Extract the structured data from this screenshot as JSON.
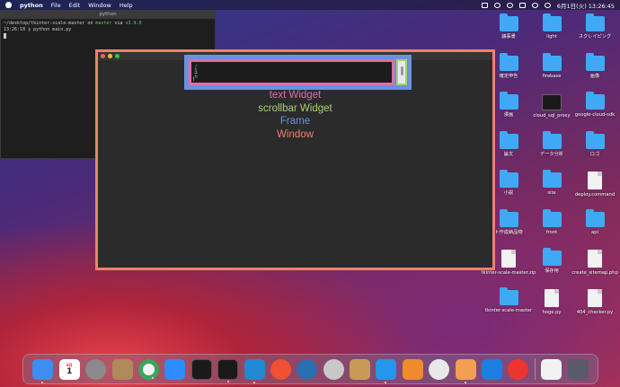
{
  "menubar": {
    "app_name": "python",
    "menus": [
      "File",
      "Edit",
      "Window",
      "Help"
    ],
    "clock": "6月1日(火) 13:26:45"
  },
  "terminal": {
    "title": "python",
    "prompt_path": "~/desktop/tkinter-scale-master",
    "on": "on",
    "branch": "master",
    "via": "via",
    "python_version": "v3.9.0",
    "timestamp": "13:26:10",
    "command": "python main.py"
  },
  "tk_window": {
    "text_content": "ノミネカ",
    "labels": [
      {
        "text": "text Widget",
        "color": "#e06fa0"
      },
      {
        "text": "scrollbar Widget",
        "color": "#a6d16e"
      },
      {
        "text": "Frame",
        "color": "#6c8fe0"
      },
      {
        "text": "Window",
        "color": "#f08070"
      }
    ]
  },
  "desktop_icons": [
    {
      "label": "議事書",
      "kind": "folder"
    },
    {
      "label": "light",
      "kind": "folder"
    },
    {
      "label": "スクレイピング",
      "kind": "folder"
    },
    {
      "label": "確定申告",
      "kind": "folder"
    },
    {
      "label": "firebase",
      "kind": "folder"
    },
    {
      "label": "画像",
      "kind": "folder"
    },
    {
      "label": "漫画",
      "kind": "folder"
    },
    {
      "label": "cloud_sql_proxy",
      "kind": "dark"
    },
    {
      "label": "google-cloud-sdk",
      "kind": "folder"
    },
    {
      "label": "論文",
      "kind": "folder"
    },
    {
      "label": "データ分析",
      "kind": "folder"
    },
    {
      "label": "ロゴ",
      "kind": "folder"
    },
    {
      "label": "小説",
      "kind": "folder"
    },
    {
      "label": "site",
      "kind": "folder"
    },
    {
      "label": "deploy.command",
      "kind": "doc"
    },
    {
      "label": "ト作成納品物",
      "kind": "folder"
    },
    {
      "label": "front",
      "kind": "folder"
    },
    {
      "label": "api",
      "kind": "folder"
    },
    {
      "label": "tkinter-scale-master.zip",
      "kind": "doc"
    },
    {
      "label": "保存用",
      "kind": "folder"
    },
    {
      "label": "create_sitemap.php",
      "kind": "doc"
    },
    {
      "label": "tkinter-scale-master",
      "kind": "folder"
    },
    {
      "label": "hoge.py",
      "kind": "doc"
    },
    {
      "label": "404_checker.py",
      "kind": "doc"
    }
  ],
  "dock": {
    "calendar_month": "6月",
    "calendar_day": "1"
  }
}
